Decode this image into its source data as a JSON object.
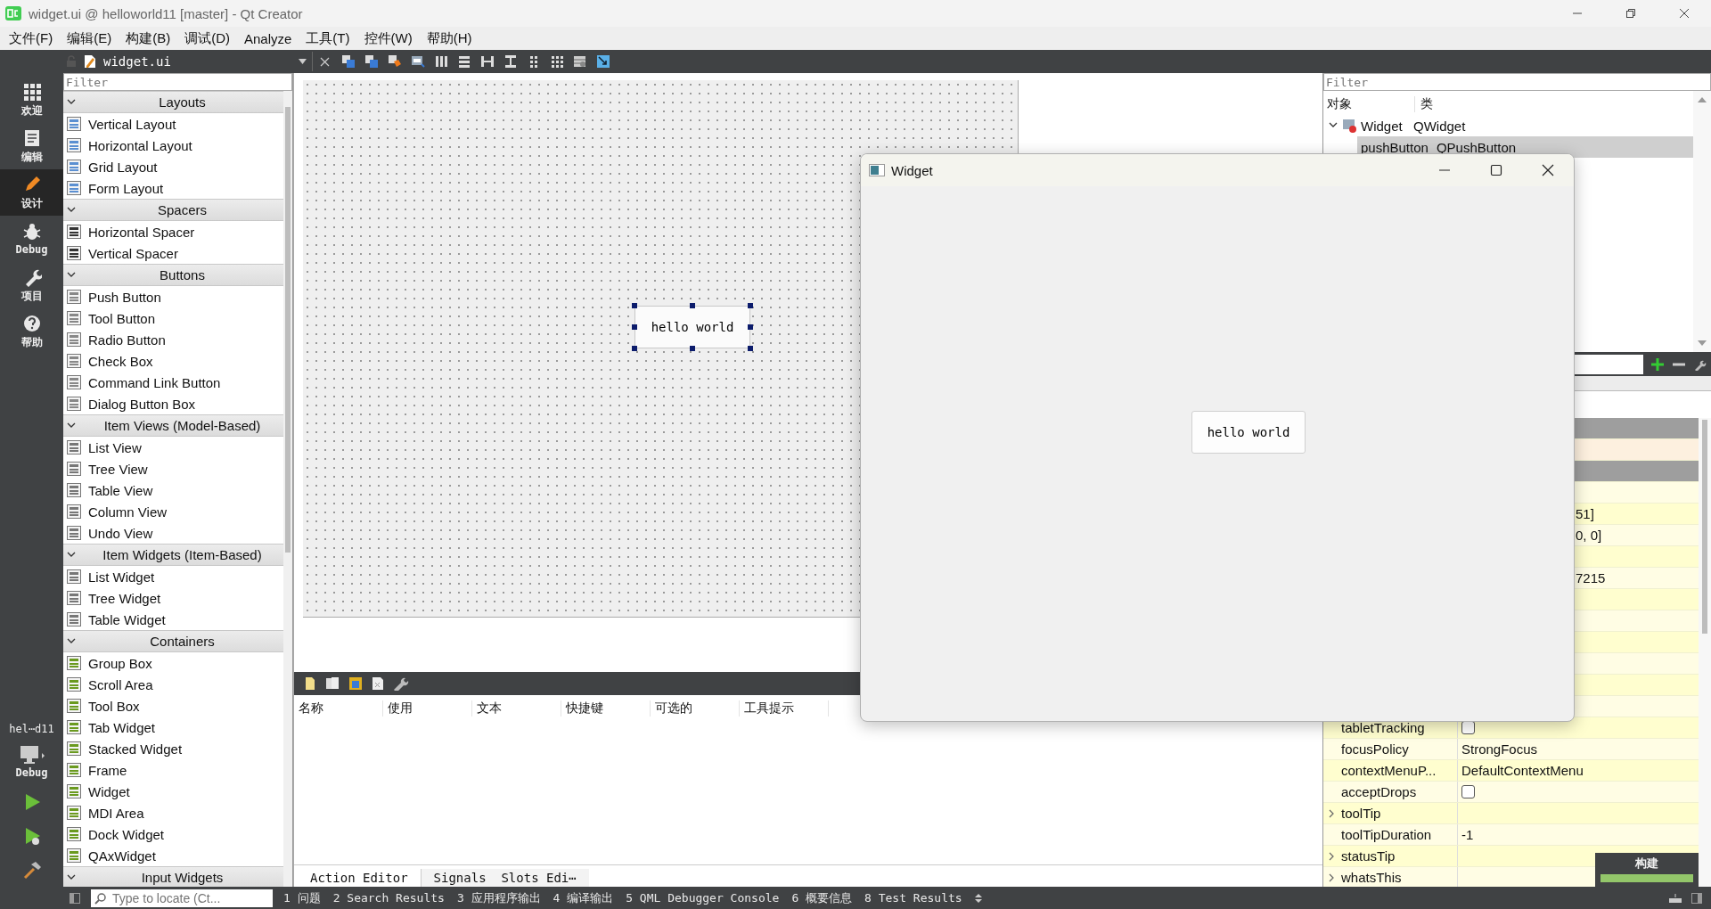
{
  "window": {
    "title": "widget.ui @ helloworld11 [master] - Qt Creator"
  },
  "menu": [
    "文件(F)",
    "编辑(E)",
    "构建(B)",
    "调试(D)",
    "Analyze",
    "工具(T)",
    "控件(W)",
    "帮助(H)"
  ],
  "editor_toolbar": {
    "file": "widget.ui"
  },
  "mode_bar": {
    "modes": [
      {
        "kind": "welcome",
        "label": "欢迎",
        "selected": false
      },
      {
        "kind": "edit",
        "label": "编辑",
        "selected": false
      },
      {
        "kind": "design",
        "label": "设计",
        "selected": true
      },
      {
        "kind": "debug",
        "label": "Debug",
        "selected": false
      },
      {
        "kind": "projects",
        "label": "项目",
        "selected": false
      },
      {
        "kind": "help",
        "label": "帮助",
        "selected": false
      }
    ],
    "project": "hel⋯d11",
    "target": "Debug"
  },
  "widget_box": {
    "filter_placeholder": "Filter",
    "categories": [
      {
        "title": "Layouts",
        "expanded": true,
        "items": [
          "Vertical Layout",
          "Horizontal Layout",
          "Grid Layout",
          "Form Layout"
        ]
      },
      {
        "title": "Spacers",
        "expanded": true,
        "items": [
          "Horizontal Spacer",
          "Vertical Spacer"
        ]
      },
      {
        "title": "Buttons",
        "expanded": true,
        "items": [
          "Push Button",
          "Tool Button",
          "Radio Button",
          "Check Box",
          "Command Link Button",
          "Dialog Button Box"
        ]
      },
      {
        "title": "Item Views (Model-Based)",
        "expanded": true,
        "items": [
          "List View",
          "Tree View",
          "Table View",
          "Column View",
          "Undo View"
        ]
      },
      {
        "title": "Item Widgets (Item-Based)",
        "expanded": true,
        "items": [
          "List Widget",
          "Tree Widget",
          "Table Widget"
        ]
      },
      {
        "title": "Containers",
        "expanded": true,
        "items": [
          "Group Box",
          "Scroll Area",
          "Tool Box",
          "Tab Widget",
          "Stacked Widget",
          "Frame",
          "Widget",
          "MDI Area",
          "Dock Widget",
          "QAxWidget"
        ]
      },
      {
        "title": "Input Widgets",
        "expanded": true
      }
    ]
  },
  "form": {
    "button": "hello world"
  },
  "action_editor": {
    "columns": [
      "名称",
      "使用",
      "文本",
      "快捷键",
      "可选的",
      "工具提示"
    ],
    "tabs": [
      {
        "label": "Action Editor",
        "selected": true
      },
      {
        "label": "Signals  Slots Edi⋯",
        "selected": false
      }
    ]
  },
  "object_inspector": {
    "filter_placeholder": "Filter",
    "columns": [
      "对象",
      "类"
    ],
    "tree": [
      {
        "object": "Widget",
        "class": "QWidget",
        "expanded": true,
        "selected": false,
        "children": [
          {
            "object": "pushButton",
            "class": "QPushButton",
            "selected": true
          }
        ]
      }
    ]
  },
  "property_editor": {
    "rows": [
      {
        "kind": "header"
      },
      {
        "kind": "highlight"
      },
      {
        "kind": "header"
      },
      {
        "kind": "property"
      },
      {
        "kind": "property",
        "value": "51]"
      },
      {
        "kind": "property",
        "value": "0, 0]"
      },
      {
        "kind": "property"
      },
      {
        "kind": "property",
        "value": "7215"
      },
      {
        "kind": "property"
      },
      {
        "kind": "property"
      },
      {
        "kind": "property"
      },
      {
        "kind": "property"
      },
      {
        "kind": "property"
      },
      {
        "kind": "property"
      },
      {
        "kind": "checkbox",
        "name": "tabletTracking",
        "checked": false
      },
      {
        "kind": "property",
        "name": "focusPolicy",
        "value": "StrongFocus"
      },
      {
        "kind": "property",
        "name": "contextMenuP...",
        "value": "DefaultContextMenu"
      },
      {
        "kind": "checkbox",
        "name": "acceptDrops",
        "checked": false
      },
      {
        "kind": "property",
        "name": "toolTip",
        "expanded": false
      },
      {
        "kind": "property",
        "name": "toolTipDuration",
        "value": "-1"
      },
      {
        "kind": "property",
        "name": "statusTip",
        "expanded": false
      },
      {
        "kind": "property",
        "name": "whatsThis",
        "expanded": false
      }
    ]
  },
  "preview_window": {
    "title": "Widget",
    "button": "hello world"
  },
  "status_bar": {
    "locate_placeholder": "Type to locate (Ct...",
    "panes": [
      "1 问题",
      "2 Search Results",
      "3 应用程序输出",
      "4 编译输出",
      "5 QML Debugger Console",
      "6 概要信息",
      "8 Test Results"
    ]
  },
  "build_progress": {
    "label": "构建",
    "level": 1
  }
}
